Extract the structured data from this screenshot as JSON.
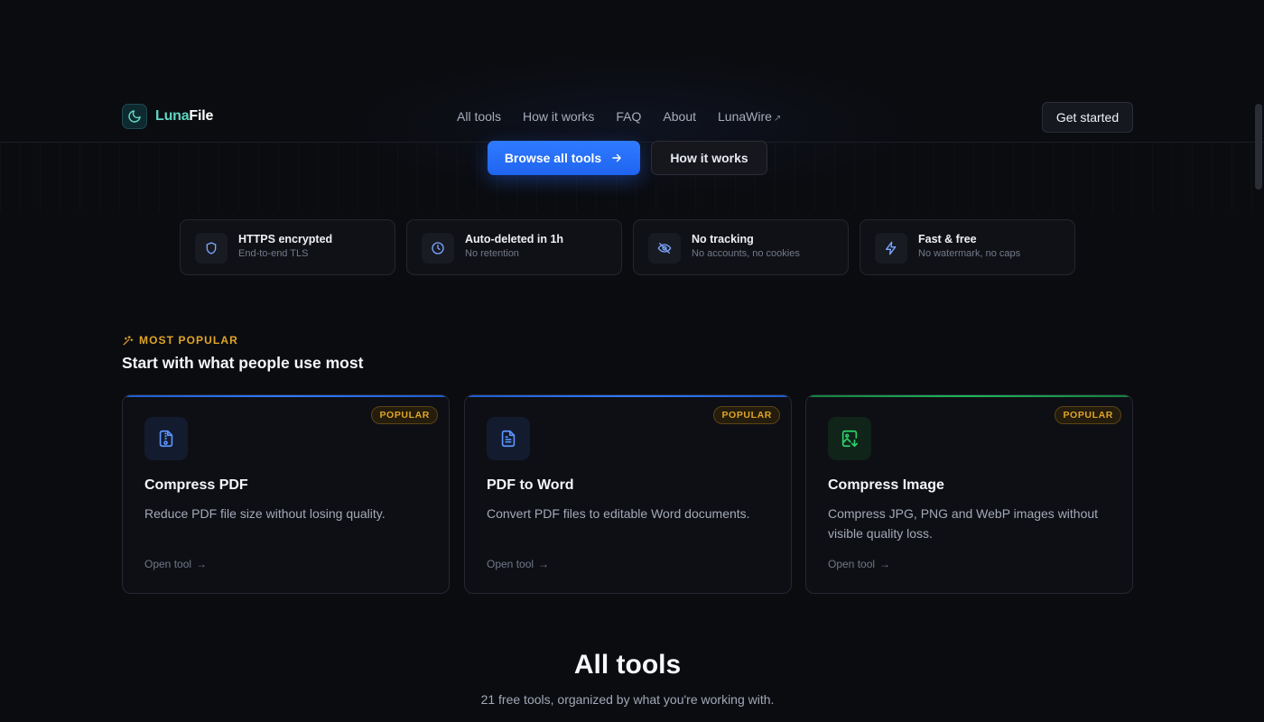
{
  "brand": {
    "name_part1": "Luna",
    "name_part2": "File"
  },
  "nav": {
    "items": [
      "All tools",
      "How it works",
      "FAQ",
      "About",
      "LunaWire"
    ],
    "external_mark": "↗",
    "cta": "Get started"
  },
  "hero": {
    "primary_button": "Browse all tools",
    "secondary_button": "How it works"
  },
  "features": [
    {
      "icon": "shield-icon",
      "title": "HTTPS encrypted",
      "subtitle": "End-to-end TLS"
    },
    {
      "icon": "clock-icon",
      "title": "Auto-deleted in 1h",
      "subtitle": "No retention"
    },
    {
      "icon": "eye-off-icon",
      "title": "No tracking",
      "subtitle": "No accounts, no cookies"
    },
    {
      "icon": "bolt-icon",
      "title": "Fast & free",
      "subtitle": "No watermark, no caps"
    }
  ],
  "popular": {
    "label": "MOST POPULAR",
    "heading": "Start with what people use most",
    "cards": [
      {
        "icon": "compress-file-icon",
        "badge": "POPULAR",
        "title": "Compress PDF",
        "description": "Reduce PDF file size without losing quality.",
        "link": "Open tool",
        "accent": "#2f6fd8"
      },
      {
        "icon": "document-icon",
        "badge": "POPULAR",
        "title": "PDF to Word",
        "description": "Convert PDF files to editable Word documents.",
        "link": "Open tool",
        "accent": "#2f6fd8"
      },
      {
        "icon": "image-download-icon",
        "badge": "POPULAR",
        "title": "Compress Image",
        "description": "Compress JPG, PNG and WebP images without visible quality loss.",
        "link": "Open tool",
        "accent": "#1fb85a"
      }
    ]
  },
  "all_tools": {
    "title": "All tools",
    "subtitle": "21 free tools, organized by what you're working with."
  },
  "colors": {
    "accent_blue": "#2f7bff",
    "accent_gold": "#e0a526",
    "accent_green": "#1fb85a",
    "logo_teal": "#5fd6c4"
  }
}
